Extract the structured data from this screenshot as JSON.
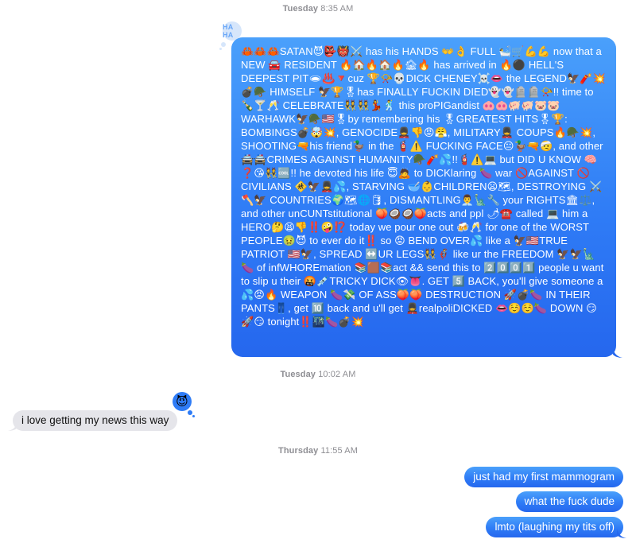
{
  "timestamps": [
    {
      "day": "Tuesday",
      "time": "8:35 AM"
    },
    {
      "day": "Tuesday",
      "time": "10:02 AM"
    },
    {
      "day": "Thursday",
      "time": "11:55 AM"
    }
  ],
  "tapbacks": {
    "haha_label": "HA HA",
    "devil_emoji": "😈"
  },
  "messages": {
    "long_outgoing": "🦀🦀🦀SATAN😈👺👹⚔️ has his HANDS 👐👌 FULL 🛀🛒💪💪 now that a NEW 🚘 RESIDENT 🔥🏠🔥🏠🔥🏚🔥 has arrived in 🔥⚫️ HELL'S DEEPEST PIT🕳♨️🔻cuz 🏆📯💀DICK CHENEY☠️👄 the LEGEND🦅🧨💥💣🪖 HIMSELF 🦅🏆🎖has FINALLY FUCKIN DIED👻👻🪦🪦📯!! time to 🍾🍸🥂 CELEBRATE👯👯💃🕺 this proPIGandist 🐽🐽🐖🐖🐷🐷 WARHAWK🦅🪖🇺🇸🎖by remembering his 🎖GREATEST HITS🎖🏆: BOMBINGS💣🤯💥, GENOCIDE💂👎😡😤, MILITARY💂 COUPS🔥🪖💥, SHOOTING🔫his friend🦆 in the 🧯⚠️ FUCKING FACE😐🦆🔫🤕, and other 🚔🚔CRIMES AGAINST HUMANITY🪖🧨💦!!🧯⚠️💻 but DID U KNOW 🧠❓😘👯🆒!! he devoted his life 😇🙇 to DICKlaring 🍆 war 🚫AGAINST 🚫 CIVILIANS 🚸🦅💂💦, STARVING 🥣👶CHILDREN😦🗺, DESTROYING ⚔️🪓🦅 COUNTRIES🌍🗺🌐🛢, DISMANTLING👨‍💼🗽🔧 your RIGHTS🏛⚖️, and other unCUNTstitutional 🍑🥥🥥🍑acts and ppl 🌶☎️ called 💻 him a HERO🤔😫👎‼️🤪⁉️ today we pour one out 🍻🥂 for one of the WORST PEOPLE🤢😈 to ever do it‼️ so 😡 BEND OVER💦 like a 🦅🇺🇸TRUE PATRIOT 🇺🇸🦅, SPREAD ↔️UR LEGS👯🦸 like ur the FREEDOM 🦅🦅🗽🍆 of infWHOREmation 📚🟫📚act && send this to 2️⃣0️⃣0️⃣1️⃣ people u want to slip u their 🤬💉TRICKY DICK👁👅. GET 5️⃣ BACK, you'll give someone a 💦😡🔥 WEAPON 🍆💸 OF ASS🍑🍑 DESTRUCTION 🚀💣🍆 IN THEIR PANTS👖, get 🔟 back and u'll get 💂realpoliDICKED 👄☺️☺️🍆 DOWN 😏🚀😏 tonight‼️🌃🍆💣💥",
    "incoming_reply": "i love getting my news this way",
    "outgoing_1": "just had my first mammogram",
    "outgoing_2": "what the fuck dude",
    "outgoing_3": "lmto (laughing my tits off)"
  }
}
